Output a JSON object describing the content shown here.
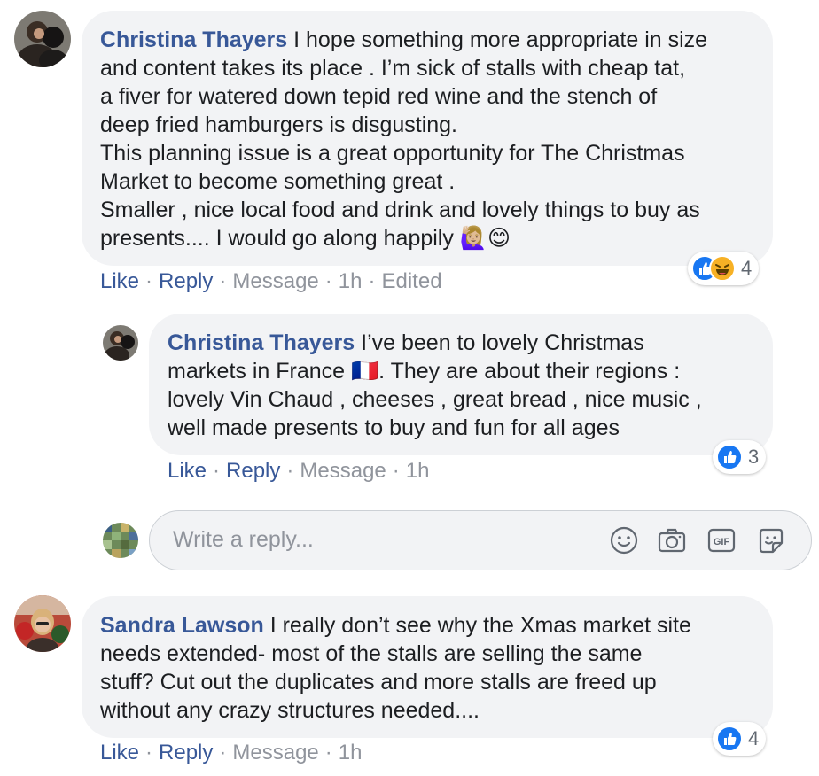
{
  "comments": [
    {
      "author": "Christina Thayers",
      "text": " I hope something more appropriate in size\nand content takes its place . I’m sick of stalls with cheap tat,\na fiver for watered down tepid red wine and the stench of\ndeep fried hamburgers is disgusting.\nThis planning issue is a great opportunity for The Christmas\nMarket to become something great .\nSmaller , nice local food and drink and lovely things to buy as\npresents.... I would go along happily ",
      "emoji": "🙋🏼‍♀️😊",
      "actions": {
        "like": "Like",
        "reply": "Reply",
        "message": "Message",
        "time": "1h",
        "edited": "Edited"
      },
      "reactions": {
        "types": [
          "like",
          "haha"
        ],
        "count": "4"
      }
    },
    {
      "author": "Christina Thayers",
      "text": " I’ve been to lovely Christmas\nmarkets in France ",
      "flag": "🇫🇷",
      "text2": ". They are about their regions :\nlovely Vin Chaud , cheeses , great bread , nice music ,\nwell made presents to buy and fun for all ages",
      "actions": {
        "like": "Like",
        "reply": "Reply",
        "message": "Message",
        "time": "1h"
      },
      "reactions": {
        "types": [
          "like"
        ],
        "count": "3"
      }
    },
    {
      "author": "Sandra Lawson",
      "text": " I really don’t see why the Xmas market site\nneeds extended- most of the stalls are selling the same\nstuff? Cut out the duplicates and more stalls are freed up\nwithout any crazy structures needed....",
      "actions": {
        "like": "Like",
        "reply": "Reply",
        "message": "Message",
        "time": "1h"
      },
      "reactions": {
        "types": [
          "like"
        ],
        "count": "4"
      }
    }
  ],
  "reply_box": {
    "placeholder": "Write a reply...",
    "tools": [
      "emoji-icon",
      "camera-icon",
      "gif-icon",
      "sticker-icon"
    ]
  },
  "colors": {
    "link": "#385898",
    "meta": "#90949c",
    "bubble": "#f2f3f5",
    "like": "#1877f2"
  }
}
